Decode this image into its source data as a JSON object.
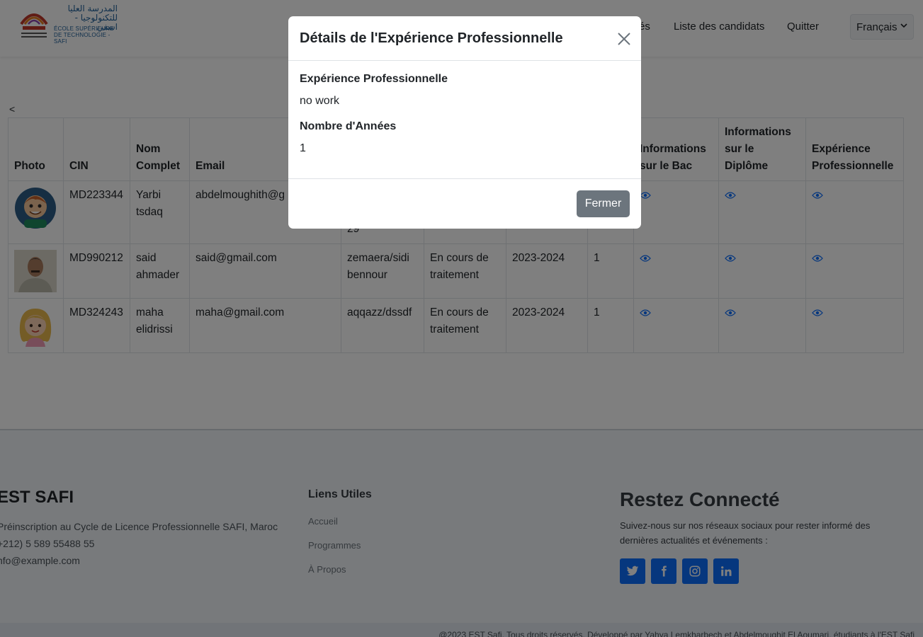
{
  "navbar": {
    "logo": {
      "arabic_line1": "المدرسة العليا",
      "arabic_line2": "للتكنولوجيا - اسفي",
      "latin_line1": "ÉCOLE SUPÉRIEURE",
      "latin_line2": "DE TECHNOLOGIE -SAFI"
    },
    "links": [
      "és",
      "Liste des candidats",
      "Quitter"
    ],
    "language": "Français"
  },
  "back_link": "<",
  "table": {
    "headers": [
      "Photo",
      "CIN",
      "Nom Complet",
      "Email",
      "",
      "",
      "",
      "",
      "Informations sur le Bac",
      "Informations sur le Diplôme",
      "Expérience Professionnelle"
    ],
    "rows": [
      {
        "cin": "MD223344",
        "name": "Yarbi tsdaq",
        "email": "abdelmoughith@g",
        "address": "29",
        "status": "",
        "year": "",
        "count": "",
        "avatar": "cartoon-boy"
      },
      {
        "cin": "MD990212",
        "name": "said ahmader",
        "email": "said@gmail.com",
        "address": "zemaera/sidi bennour",
        "status": "En cours de traitement",
        "year": "2023-2024",
        "count": "1",
        "avatar": "photo-man"
      },
      {
        "cin": "MD324243",
        "name": "maha elidrissi",
        "email": "maha@gmail.com",
        "address": "aqqazz/dssdf",
        "status": "En cours de traitement",
        "year": "2023-2024",
        "count": "1",
        "avatar": "cartoon-girl"
      }
    ]
  },
  "footer": {
    "brand": "EST SAFI",
    "info": [
      "Préinscription au Cycle de Licence Professionnelle SAFI, Maroc",
      "+212) 5 589 55488 55",
      "nfo@example.com"
    ],
    "links_title": "Liens Utiles",
    "links": [
      "Accueil",
      "Programmes",
      "À Propos"
    ],
    "social_title": "Restez Connecté",
    "social_desc": "Suivez-nous sur nos réseaux sociaux pour rester informé des dernières actualités et événements :",
    "social_icons": [
      "twitter-icon",
      "facebook-icon",
      "instagram-icon",
      "linkedin-icon"
    ],
    "copyright": "@2023 EST Safi. Tous droits réservés. Développé par Yahya Lemkharbech et Abdelmoughit El Aoumari, étudiants à l'EST Safi"
  },
  "modal": {
    "title": "Détails de l'Expérience Professionnelle",
    "label1": "Expérience Professionnelle",
    "value1": "no work",
    "label2": "Nombre d'Années",
    "value2": "1",
    "close_button": "Fermer"
  },
  "colors": {
    "accent": "#0d6efd",
    "button_secondary": "#6c757d"
  }
}
